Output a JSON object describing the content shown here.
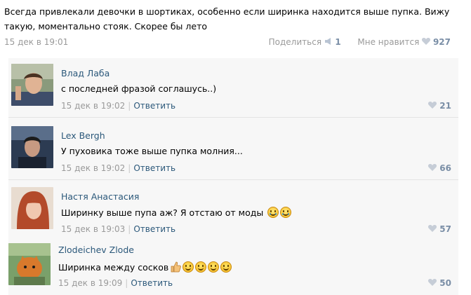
{
  "post": {
    "text": "Всегда привлекали девочки в шортиках, особенно если ширинка находится выше пупка. Вижу такую, моментально стояк. Скорее бы лето",
    "date": "15 дек в 19:01",
    "share_label": "Поделиться",
    "share_count": "1",
    "like_label": "Мне нравится",
    "like_count": "927"
  },
  "comments": [
    {
      "name": "Влад Лаба",
      "text": "с последней фразой соглашусь..)",
      "date": "15 дек в 19:02",
      "reply": "Ответить",
      "likes": "21"
    },
    {
      "name": "Lex Bergh",
      "text": "У пуховика тоже выше пупка молния...",
      "date": "15 дек в 19:02",
      "reply": "Ответить",
      "likes": "66"
    },
    {
      "name": "Настя Анастасия",
      "text": "Ширинку выше пупа аж? Я отстаю от моды",
      "date": "15 дек в 19:03",
      "reply": "Ответить",
      "likes": "57"
    },
    {
      "name": "Zlodeichev Zlode",
      "text": "Ширинка между сосков",
      "date": "15 дек в 19:09",
      "reply": "Ответить",
      "likes": "50"
    }
  ],
  "icons": {
    "share": "megaphone-icon",
    "like": "heart-icon",
    "emoji_cry": "laughing-crying-emoji-icon",
    "emoji_smile": "smiling-emoji-icon",
    "thumbs_up": "thumbs-up-icon"
  },
  "colors": {
    "link": "#2b587a",
    "meta": "#9a9a9a",
    "count": "#7a8ea6",
    "thread_bg": "#f7f7f7"
  }
}
